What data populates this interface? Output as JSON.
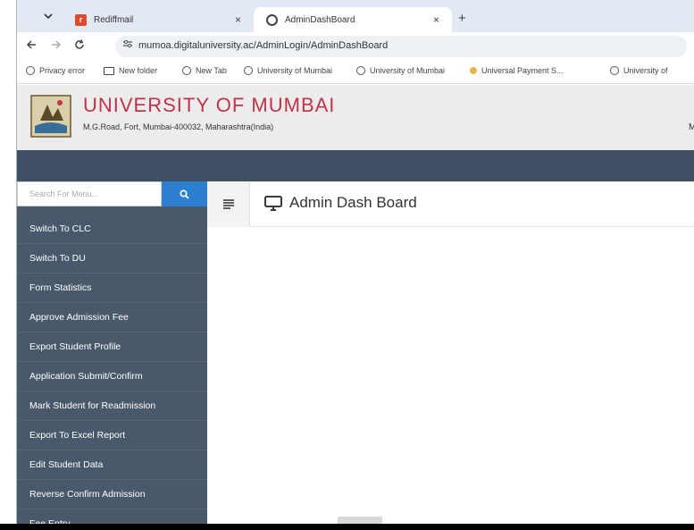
{
  "browser": {
    "tabs": [
      {
        "title": "Rediffmail",
        "active": false,
        "favicon": "rediffmail-icon"
      },
      {
        "title": "AdminDashBoard",
        "active": true,
        "favicon": "globe-icon"
      }
    ],
    "tab_list_icon": "chevron-down-icon",
    "close_glyph": "×",
    "new_tab_glyph": "+",
    "url": "mumoa.digitaluniversity.ac/AdminLogin/AdminDashBoard",
    "bookmarks": [
      {
        "label": "Privacy error",
        "icon": "globe-icon"
      },
      {
        "label": "New folder",
        "icon": "folder-icon"
      },
      {
        "label": "New Tab",
        "icon": "globe-icon"
      },
      {
        "label": "University of Mumbai",
        "icon": "globe-icon"
      },
      {
        "label": "University of Mumbai",
        "icon": "globe-icon"
      },
      {
        "label": "Universal Payment S...",
        "icon": "person-icon"
      },
      {
        "label": "University of",
        "icon": "globe-icon"
      }
    ]
  },
  "header": {
    "title": "UNIVERSITY OF MUMBAI",
    "address": "M.G.Road, Fort, Mumbai-400032, Maharashtra(India)",
    "right_text": "M",
    "title_color": "#c0334a"
  },
  "sidebar": {
    "search_placeholder": "Search For Menu...",
    "menu": [
      "Switch To CLC",
      "Switch To DU",
      "Form Statistics",
      "Approve Admission Fee",
      "Export Student Profile",
      "Application Submit/Confirm",
      "Mark Student for Readmission",
      "Export To Excel Report",
      "Edit Student Data",
      "Reverse Confirm Admission",
      "Fee Entry"
    ],
    "background": "#49596c",
    "search_button_color": "#2c7fd0"
  },
  "main": {
    "page_title": "Admin Dash Board",
    "title_icon": "monitor-icon"
  },
  "colors": {
    "topnav": "#3e4f63",
    "header_bg": "#ececec"
  }
}
